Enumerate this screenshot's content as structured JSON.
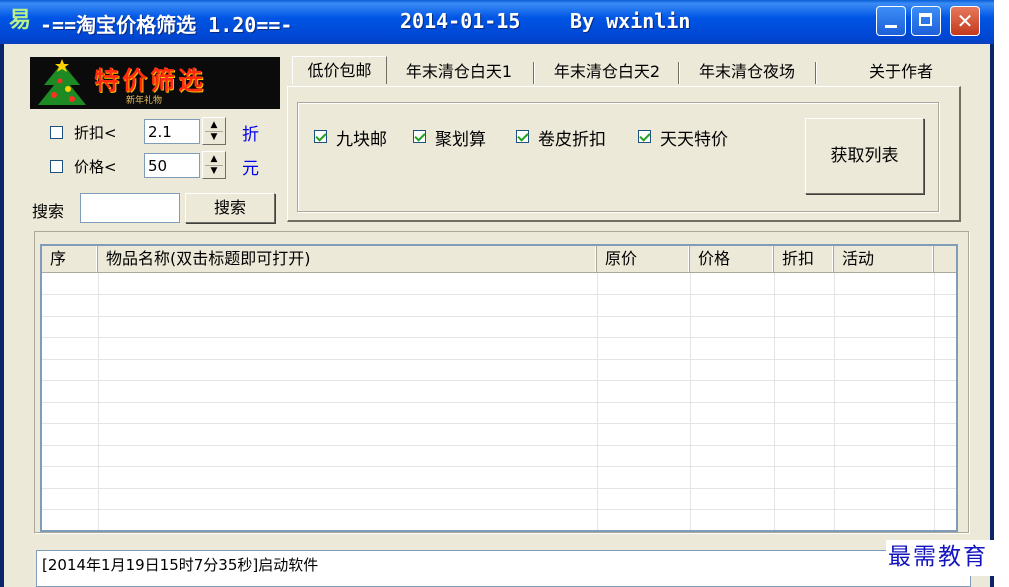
{
  "window": {
    "title": "-==淘宝价格筛选 1.20==-",
    "date": "2014-01-15",
    "author": "By wxinlin",
    "app_icon": "易"
  },
  "logo": {
    "title": "特价筛选",
    "subtitle": "新年礼物"
  },
  "filters": {
    "discount": {
      "label": "折扣<",
      "value": "2.1",
      "unit": "折",
      "checked": false
    },
    "price": {
      "label": "价格<",
      "value": "50",
      "unit": "元",
      "checked": false
    }
  },
  "search": {
    "label": "搜索",
    "value": "",
    "button": "搜索"
  },
  "tabs": [
    {
      "label": "低价包邮",
      "active": true
    },
    {
      "label": "年末清仓白天1",
      "active": false
    },
    {
      "label": "年末清仓白天2",
      "active": false
    },
    {
      "label": "年末清仓夜场",
      "active": false
    },
    {
      "label": "关于作者",
      "active": false
    }
  ],
  "options": [
    {
      "label": "九块邮",
      "checked": true
    },
    {
      "label": "聚划算",
      "checked": true
    },
    {
      "label": "卷皮折扣",
      "checked": true
    },
    {
      "label": "天天特价",
      "checked": true
    }
  ],
  "fetch_button": "获取列表",
  "table": {
    "columns": [
      "序",
      "物品名称(双击标题即可打开)",
      "原价",
      "价格",
      "折扣",
      "活动"
    ],
    "rows": []
  },
  "status": "[2014年1月19日15时7分35秒]启动软件",
  "watermark": "最需教育",
  "colors": {
    "titlebar": "#0055e5",
    "face": "#ece9d8",
    "unit_text": "#0000ee",
    "watermark": "#1515c0"
  }
}
